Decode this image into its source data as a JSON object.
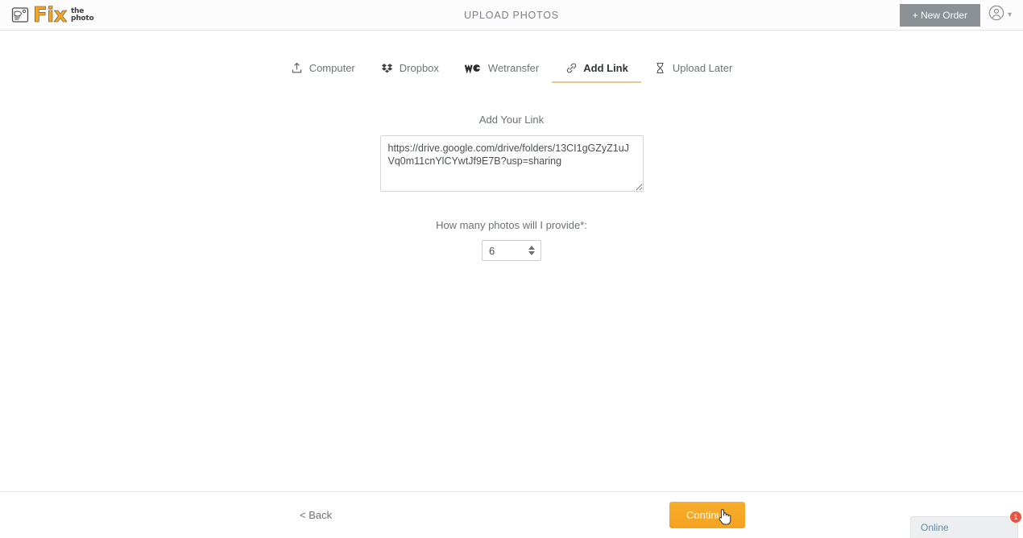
{
  "header": {
    "logo": {
      "mark_icon": "camera-hand-icon",
      "word": "Fix",
      "line1": "the",
      "line2": "photo"
    },
    "title": "UPLOAD PHOTOS",
    "new_order_label": "+ New Order",
    "account_icon": "user-avatar-icon",
    "chevron_icon": "chevron-down-icon"
  },
  "tabs": [
    {
      "id": "computer",
      "label": "Computer",
      "icon": "upload-icon",
      "active": false
    },
    {
      "id": "dropbox",
      "label": "Dropbox",
      "icon": "dropbox-icon",
      "active": false
    },
    {
      "id": "wetransfer",
      "label": "Wetransfer",
      "icon": "wetransfer-icon",
      "active": false
    },
    {
      "id": "add-link",
      "label": "Add Link",
      "icon": "link-icon",
      "active": true
    },
    {
      "id": "upload-later",
      "label": "Upload Later",
      "icon": "hourglass-icon",
      "active": false
    }
  ],
  "form": {
    "link_label": "Add Your Link",
    "link_value": "https://drive.google.com/drive/folders/13CI1gGZyZ1uJVq0m11cnYlCYwtJf9E7B?usp=sharing",
    "link_placeholder": "Add Your Link",
    "count_label": "How many photos will I provide*:",
    "count_value": "6"
  },
  "footer": {
    "back_label": "< Back",
    "continue_label": "Continue"
  },
  "chat": {
    "status_label": "Online",
    "unread_count": "1"
  },
  "colors": {
    "accent_orange": "#F5A623",
    "tab_underline": "#E8C98B",
    "badge_red": "#E8543F",
    "header_button_gray": "#8C9196"
  }
}
